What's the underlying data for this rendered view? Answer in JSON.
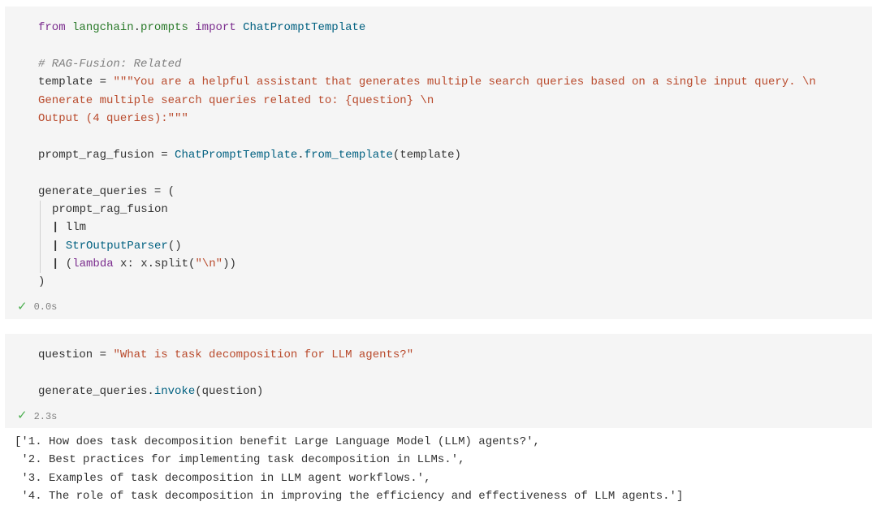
{
  "cells": [
    {
      "status": {
        "icon": "check",
        "time": "0.0s"
      },
      "code": {
        "line1": {
          "kw_from": "from",
          "module1": "langchain",
          "dot": ".",
          "module2": "prompts",
          "kw_import": "import",
          "cls": "ChatPromptTemplate"
        },
        "comment": "# RAG-Fusion: Related",
        "template_assign": {
          "var": "template",
          "eq": " = ",
          "q": "\"\"\"",
          "body": "You are a helpful assistant that generates multiple search queries based on a single input query. \\n"
        },
        "template_line2": "Generate multiple search queries related to: {question} \\n",
        "template_line3": {
          "body": "Output (4 queries):",
          "q": "\"\"\""
        },
        "prompt_assign": {
          "var": "prompt_rag_fusion",
          "eq": " = ",
          "cls": "ChatPromptTemplate",
          "dot": ".",
          "method": "from_template",
          "open": "(",
          "arg": "template",
          "close": ")"
        },
        "gen_assign": {
          "var": "generate_queries",
          "eq": " = ("
        },
        "gl1": "prompt_rag_fusion",
        "gl2_pipe": "|",
        "gl2_val": " llm",
        "gl3_pipe": "|",
        "gl3_cls": "StrOutputParser",
        "gl3_paren": "()",
        "gl4_pipe": "|",
        "gl4_open": " (",
        "gl4_lambda": "lambda",
        "gl4_rest": " x: x.split(",
        "gl4_str": "\"\\n\"",
        "gl4_close": "))",
        "close": ")"
      }
    },
    {
      "status": {
        "icon": "check",
        "time": "2.3s"
      },
      "code": {
        "q_assign": {
          "var": "question",
          "eq": " = ",
          "str": "\"What is task decomposition for LLM agents?\""
        },
        "invoke": {
          "obj": "generate_queries",
          "dot": ".",
          "method": "invoke",
          "open": "(",
          "arg": "question",
          "close": ")"
        }
      },
      "output": "['1. How does task decomposition benefit Large Language Model (LLM) agents?',\n '2. Best practices for implementing task decomposition in LLMs.',\n '3. Examples of task decomposition in LLM agent workflows.',\n '4. The role of task decomposition in improving the efficiency and effectiveness of LLM agents.']"
    }
  ]
}
